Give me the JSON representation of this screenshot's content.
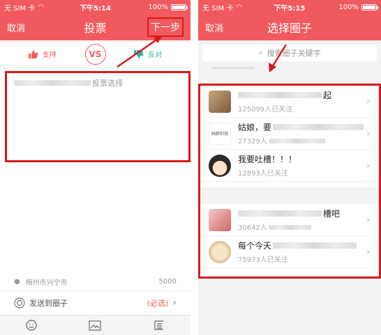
{
  "status": {
    "carrier": "无 SIM 卡",
    "battery": "100%"
  },
  "left": {
    "time": "下午5:14",
    "nav": {
      "cancel": "取消",
      "title": "投票",
      "next": "下一步"
    },
    "vote": {
      "support": "支持",
      "vs": "VS",
      "oppose": "反对"
    },
    "editor": {
      "placeholder_visible": "投票选择"
    },
    "location": "梅州市兴宁市",
    "char_count": "5000",
    "send": {
      "label": "发送到圈子",
      "required": "(必选)"
    },
    "icons": [
      "emoji-icon",
      "image-icon",
      "list-icon"
    ]
  },
  "right": {
    "time": "下午5:15",
    "nav": {
      "cancel": "取消",
      "title": "选择圈子"
    },
    "search": {
      "placeholder_visible": "搜索圈子关键字"
    },
    "items": [
      {
        "name_visible": "起",
        "fans": "125099人已关注"
      },
      {
        "name_visible": "姑娘，要",
        "fans": "27329人",
        "avatar_text": "姑娘别说"
      },
      {
        "name_visible": "我要吐槽！！！",
        "fans": "12893人已关注"
      },
      {
        "name_visible": "槽吧",
        "fans": "30642人"
      },
      {
        "name_visible": "每个今天",
        "fans": "75973人已关注"
      }
    ]
  },
  "colors": {
    "brand": "#f05a5f",
    "highlight": "#d61a1a",
    "oppose": "#2bb3a3"
  }
}
